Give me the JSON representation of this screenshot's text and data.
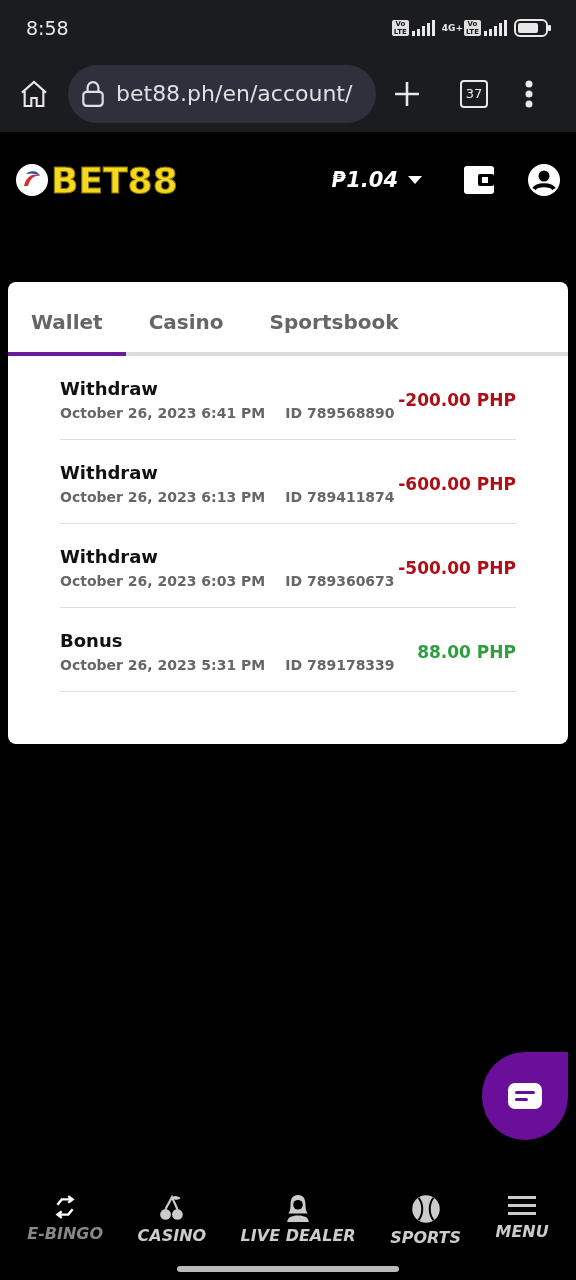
{
  "status_bar": {
    "time": "8:58",
    "sim_badges": [
      "Vo LTE",
      "Vo LTE"
    ],
    "network": "4G+"
  },
  "browser": {
    "url": "bet88.ph/en/account/",
    "tab_count": "37"
  },
  "header": {
    "logo": "BET88",
    "balance": "₱1.04"
  },
  "tabs": [
    {
      "label": "Wallet",
      "selected": true
    },
    {
      "label": "Casino",
      "selected": false
    },
    {
      "label": "Sportsbook",
      "selected": false
    }
  ],
  "transactions": [
    {
      "type": "Withdraw",
      "date": "October 26, 2023 6:41 PM",
      "id": "ID 789568890",
      "amount": "-200.00 PHP",
      "kind": "debit"
    },
    {
      "type": "Withdraw",
      "date": "October 26, 2023 6:13 PM",
      "id": "ID 789411874",
      "amount": "-600.00 PHP",
      "kind": "debit"
    },
    {
      "type": "Withdraw",
      "date": "October 26, 2023 6:03 PM",
      "id": "ID 789360673",
      "amount": "-500.00 PHP",
      "kind": "debit"
    },
    {
      "type": "Bonus",
      "date": "October 26, 2023 5:31 PM",
      "id": "ID 789178339",
      "amount": "88.00 PHP",
      "kind": "credit"
    }
  ],
  "bottom_nav": [
    {
      "label": "E-BINGO",
      "kind": "bingo"
    },
    {
      "label": "CASINO",
      "kind": "casino"
    },
    {
      "label": "LIVE DEALER",
      "kind": "dealer"
    },
    {
      "label": "SPORTS",
      "kind": "sports"
    },
    {
      "label": "MENU",
      "kind": "menu"
    }
  ]
}
